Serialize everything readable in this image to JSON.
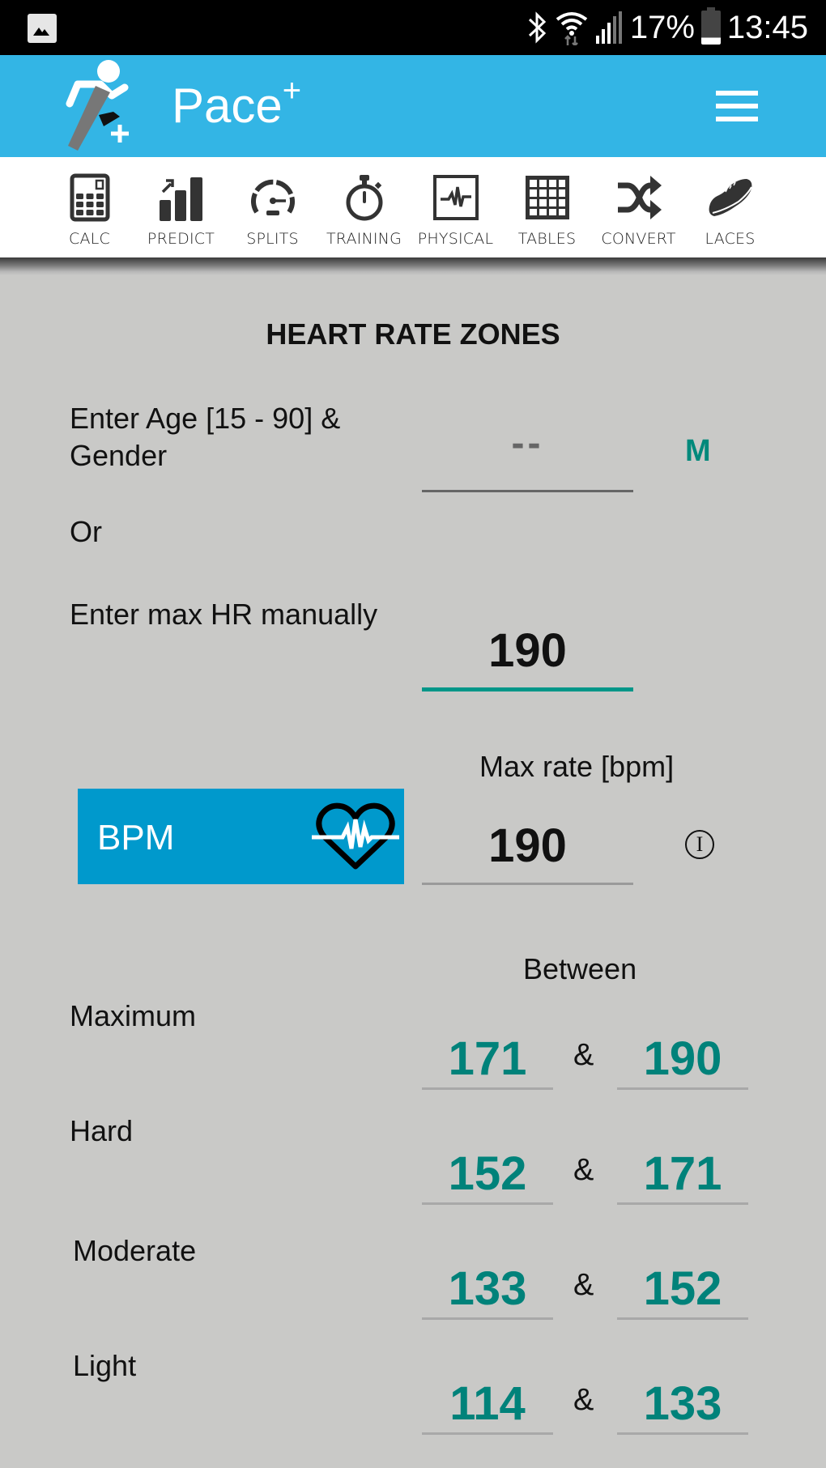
{
  "status_bar": {
    "battery": "17%",
    "time": "13:45",
    "icons": [
      "gallery-icon",
      "bluetooth-icon",
      "wifi-icon",
      "signal-icon",
      "battery-icon"
    ]
  },
  "app_bar": {
    "title": "Pace",
    "title_superscript": "+",
    "color": "#33b5e5",
    "menu_icon": "hamburger-menu-icon"
  },
  "toolbar": {
    "items": [
      {
        "label": "CALC",
        "icon": "calculator-icon"
      },
      {
        "label": "PREDICT",
        "icon": "bar-chart-trend-icon"
      },
      {
        "label": "SPLITS",
        "icon": "speedometer-icon"
      },
      {
        "label": "TRAINING",
        "icon": "stopwatch-icon"
      },
      {
        "label": "PHYSICAL",
        "icon": "heartbeat-monitor-icon"
      },
      {
        "label": "TABLES",
        "icon": "grid-table-icon"
      },
      {
        "label": "CONVERT",
        "icon": "shuffle-icon"
      },
      {
        "label": "LACES",
        "icon": "running-shoe-icon"
      }
    ]
  },
  "main": {
    "title": "HEART RATE ZONES",
    "age_label": "Enter Age [15 - 90] &",
    "age_label_line2": "Gender",
    "age_placeholder": "--",
    "gender": "M",
    "or_label": "Or",
    "manual_label": "Enter max HR manually",
    "manual_value": "190",
    "bpm_button": "BPM",
    "bpm_icon": "heart-pulse-icon",
    "max_rate_label": "Max rate [bpm]",
    "max_rate_value": "190",
    "info_icon": "info-icon",
    "info_glyph": "I",
    "between_label": "Between",
    "separator": "&",
    "accent_color": "#00827a",
    "zones": [
      {
        "name": "Maximum",
        "low": "171",
        "high": "190"
      },
      {
        "name": "Hard",
        "low": "152",
        "high": "171"
      },
      {
        "name": "Moderate",
        "low": "133",
        "high": "152"
      },
      {
        "name": "Light",
        "low": "114",
        "high": "133"
      }
    ]
  }
}
